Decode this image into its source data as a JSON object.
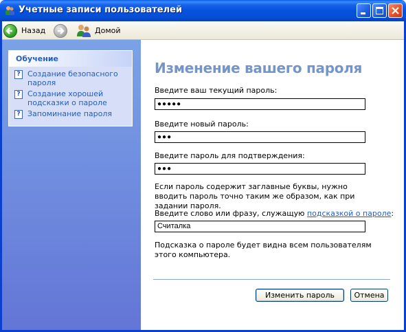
{
  "window": {
    "title": "Учетные записи пользователей"
  },
  "toolbar": {
    "back_label": "Назад",
    "home_label": "Домой"
  },
  "sidebar": {
    "heading": "Обучение",
    "items": [
      {
        "label": "Создание безопасного пароля"
      },
      {
        "label": "Создание хорошей подсказки о пароле"
      },
      {
        "label": "Запоминание пароля"
      }
    ]
  },
  "form": {
    "title": "Изменение вашего пароля",
    "current_password": {
      "label": "Введите ваш текущий пароль:",
      "value": "●●●●●"
    },
    "new_password": {
      "label": "Введите новый пароль:",
      "value": "●●●"
    },
    "confirm_password": {
      "label": "Введите пароль для подтверждения:",
      "value": "●●●"
    },
    "case_note": "Если пароль содержит заглавные буквы, нужно вводить пароль точно таким же образом, как при задании пароля.",
    "hint": {
      "label_prefix": "Введите слово или фразу, служащую ",
      "label_link": "подсказкой о пароле",
      "label_suffix": ":",
      "value": "Считалка"
    },
    "hint_note": "Подсказка о пароле будет видна всем пользователям этого компьютера.",
    "submit_label": "Изменить пароль",
    "cancel_label": "Отмена"
  },
  "colors": {
    "titlebar": "#0552dc",
    "sidebar": "#6f8ce0",
    "heading": "#7595c8",
    "link": "#215dc6"
  }
}
